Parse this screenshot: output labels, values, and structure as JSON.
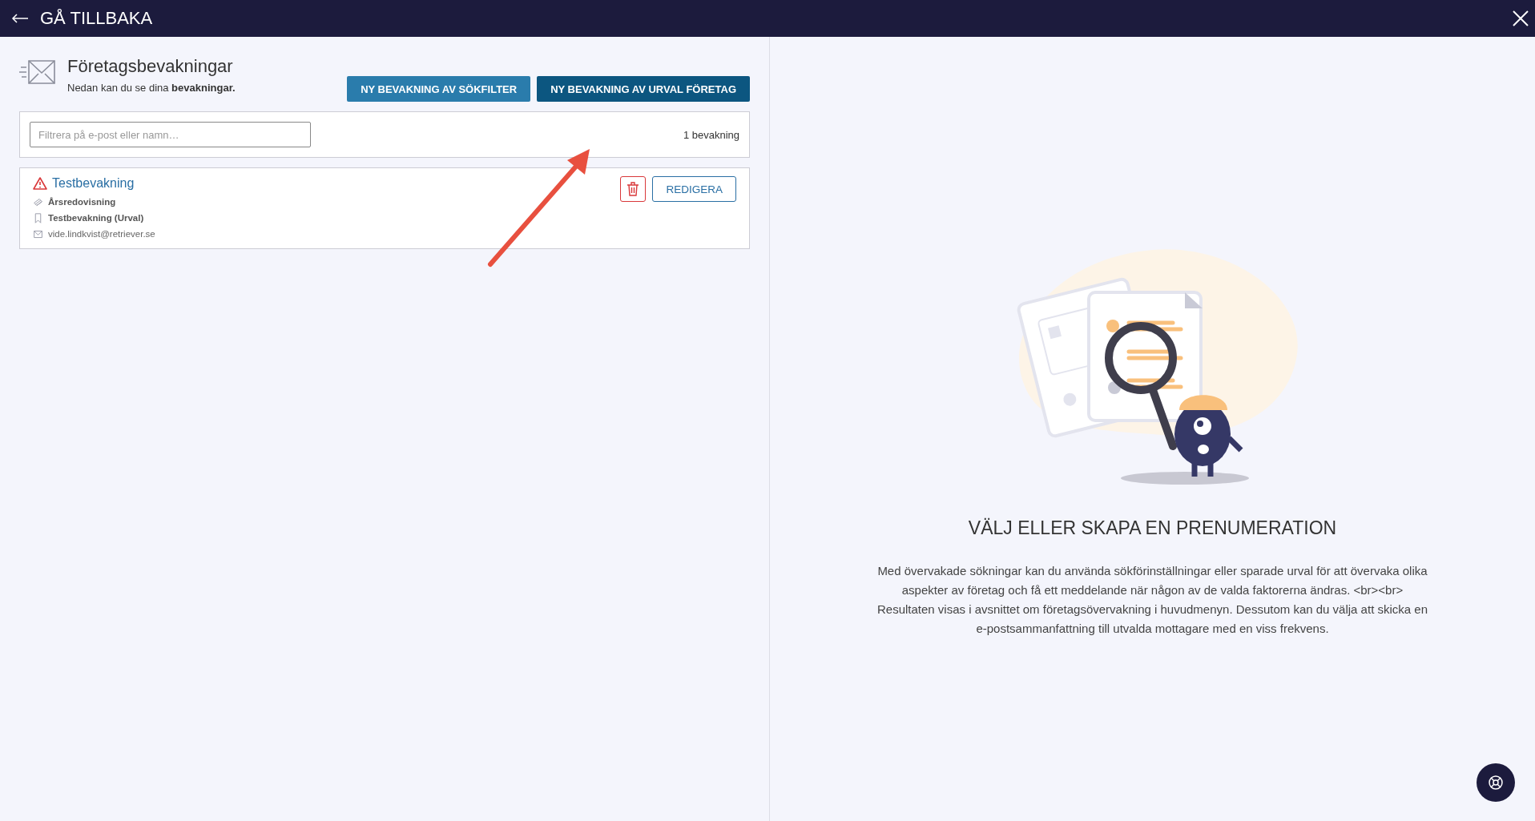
{
  "header": {
    "back_label": "GÅ TILLBAKA"
  },
  "page": {
    "title": "Företagsbevakningar",
    "subtitle": "Nedan kan du se dina **bevakningar.**"
  },
  "actions": [
    "NY BEVAKNING AV SÖKFILTER",
    "NY BEVAKNING AV URVAL FÖRETAG"
  ],
  "filter": {
    "placeholder": "Filtrera på e-post eller namn…",
    "count": "1 bevakning"
  },
  "subscriptions": [
    {
      "name": "Testbevakning",
      "warning": true,
      "details": [
        {
          "kind": "category",
          "text": "Årsredovisning"
        },
        {
          "kind": "selection",
          "text": "Testbevakning (Urval)"
        },
        {
          "kind": "email",
          "text": "vide.lindkvist@retriever.se"
        }
      ],
      "edit_label": "REDIGERA"
    }
  ],
  "empty_state": {
    "heading": "VÄLJ ELLER SKAPA EN PRENUMERATION",
    "text": "Med övervakade sökningar kan du använda sökförinställningar eller sparade urval för att övervaka olika aspekter av företag och få ett meddelande när någon av de valda faktorerna ändras. <br><br> Resultaten visas i avsnittet om företagsövervakning i huvudmenyn. Dessutom kan du välja att skicka en e-postsammanfattning till utvalda mottagare med en viss frekvens."
  }
}
